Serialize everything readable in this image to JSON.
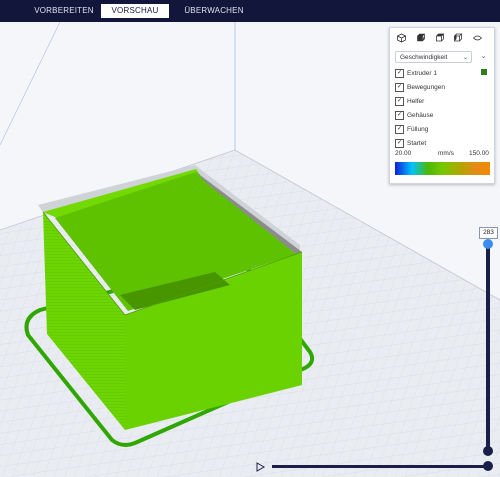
{
  "stages": [
    {
      "label": "VORBEREITEN",
      "active": false
    },
    {
      "label": "VORSCHAU",
      "active": true
    },
    {
      "label": "ÜBERWACHEN",
      "active": false
    }
  ],
  "view_buttons": [
    "3d-view-icon",
    "front-view-icon",
    "top-view-icon",
    "left-view-icon",
    "right-view-icon"
  ],
  "color_scheme": {
    "selected": "Geschwindigkeit"
  },
  "layer_types": [
    {
      "label": "Extruder 1",
      "checked": true,
      "color": "#2f7d1c"
    },
    {
      "label": "Bewegungen",
      "checked": true
    },
    {
      "label": "Helfer",
      "checked": true
    },
    {
      "label": "Gehäuse",
      "checked": true
    },
    {
      "label": "Füllung",
      "checked": true
    },
    {
      "label": "Startet",
      "checked": true
    }
  ],
  "speed_scale": {
    "min": "20.00",
    "unit": "mm/s",
    "max": "150.00"
  },
  "layer_slider": {
    "current_layer": "283",
    "level": 1.0
  },
  "simulation": {
    "progress": 1.0
  },
  "colors": {
    "model": "#6dd600",
    "topbar": "#12163a",
    "slider": "#1a1f4a",
    "accent": "#3c8cf0"
  }
}
